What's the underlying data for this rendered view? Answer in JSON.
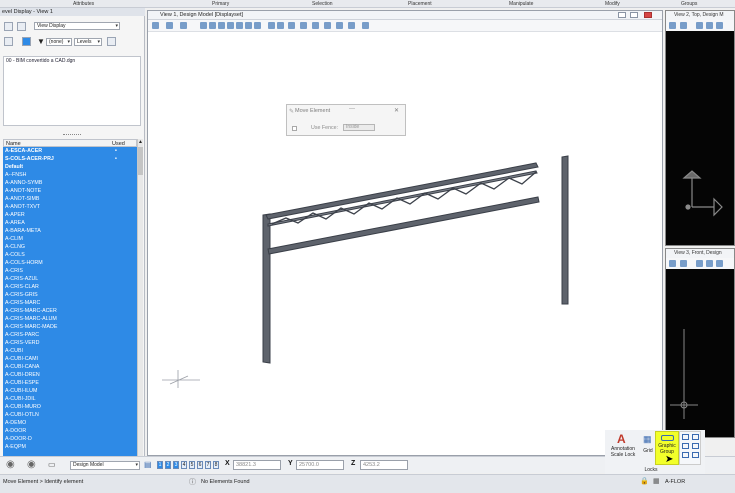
{
  "ribbon": {
    "tabs": [
      "Attributes",
      "Primary",
      "Selection",
      "Placement",
      "Manipulate",
      "Modify",
      "Groups"
    ]
  },
  "level_panel": {
    "title": "evel Display - View 1",
    "view_select": "View Display",
    "filter_select": "(none)",
    "levels_select": "Levels",
    "file_item": "00 - BIM convertido a CAD.dgn",
    "col_name": "Name",
    "col_used": "Used",
    "levels": [
      {
        "name": "A-ESCA-ACER",
        "used": "•",
        "bold": true
      },
      {
        "name": "S-COLS-ACER-PRJ",
        "used": "•",
        "bold": true
      },
      {
        "name": "Default",
        "used": "",
        "bold": true
      },
      {
        "name": "A--FNSH",
        "used": ""
      },
      {
        "name": "A-ANNO-SYMB",
        "used": ""
      },
      {
        "name": "A-ANOT-NOTE",
        "used": ""
      },
      {
        "name": "A-ANOT-SIMB",
        "used": ""
      },
      {
        "name": "A-ANOT-TXVT",
        "used": ""
      },
      {
        "name": "A-APER",
        "used": ""
      },
      {
        "name": "A-AREA",
        "used": ""
      },
      {
        "name": "A-BARA-META",
        "used": ""
      },
      {
        "name": "A-CLIM",
        "used": ""
      },
      {
        "name": "A-CLNG",
        "used": ""
      },
      {
        "name": "A-COLS",
        "used": ""
      },
      {
        "name": "A-COLS-HORM",
        "used": ""
      },
      {
        "name": "A-CRIS",
        "used": ""
      },
      {
        "name": "A-CRIS-AZUL",
        "used": ""
      },
      {
        "name": "A-CRIS-CLAR",
        "used": ""
      },
      {
        "name": "A-CRIS-GRIS",
        "used": ""
      },
      {
        "name": "A-CRIS-MARC",
        "used": ""
      },
      {
        "name": "A-CRIS-MARC-ACER",
        "used": ""
      },
      {
        "name": "A-CRIS-MARC-ALUM",
        "used": ""
      },
      {
        "name": "A-CRIS-MARC-MADE",
        "used": ""
      },
      {
        "name": "A-CRIS-PARC",
        "used": ""
      },
      {
        "name": "A-CRIS-VERD",
        "used": ""
      },
      {
        "name": "A-CUBI",
        "used": ""
      },
      {
        "name": "A-CUBI-CAMI",
        "used": ""
      },
      {
        "name": "A-CUBI-CANA",
        "used": ""
      },
      {
        "name": "A-CUBI-DREN",
        "used": ""
      },
      {
        "name": "A-CUBI-ESPE",
        "used": ""
      },
      {
        "name": "A-CUBI-ILUM",
        "used": ""
      },
      {
        "name": "A-CUBI-JDIL",
        "used": ""
      },
      {
        "name": "A-CUBI-MURO",
        "used": ""
      },
      {
        "name": "A-CUBI-OTLN",
        "used": ""
      },
      {
        "name": "A-DEMO",
        "used": ""
      },
      {
        "name": "A-DOOR",
        "used": ""
      },
      {
        "name": "A-DOOR-D",
        "used": ""
      },
      {
        "name": "A-EQPM",
        "used": ""
      }
    ]
  },
  "view1": {
    "title": "View 1, Design Model [Displayset]"
  },
  "move_dialog": {
    "title": "Move Element",
    "fence_label": "Use Fence:",
    "fence_mode": "Inside"
  },
  "view2": {
    "title": "View 2, Top, Design M"
  },
  "view3": {
    "title": "View 3, Front, Design"
  },
  "bottom_toolbar": {
    "model_select": "Design Model",
    "view_numbers": [
      "1",
      "2",
      "3",
      "4",
      "5",
      "6",
      "7",
      "8"
    ],
    "x_label": "X",
    "x_value": "38821.3",
    "y_label": "Y",
    "y_value": "25700.0",
    "z_label": "Z",
    "z_value": "4253.2"
  },
  "locks": {
    "annotation_scale_lock": "Annotation Scale Lock",
    "grid": "Grid",
    "graphic_group": "Graphic Group",
    "locks_label": "Locks"
  },
  "status": {
    "prompt": "Move Element > Identify element",
    "message": "No Elements Found",
    "level": "A-FLOR"
  },
  "colors": {
    "selection_blue": "#2e8ae6",
    "highlight_yellow": "#f2ff2a"
  }
}
